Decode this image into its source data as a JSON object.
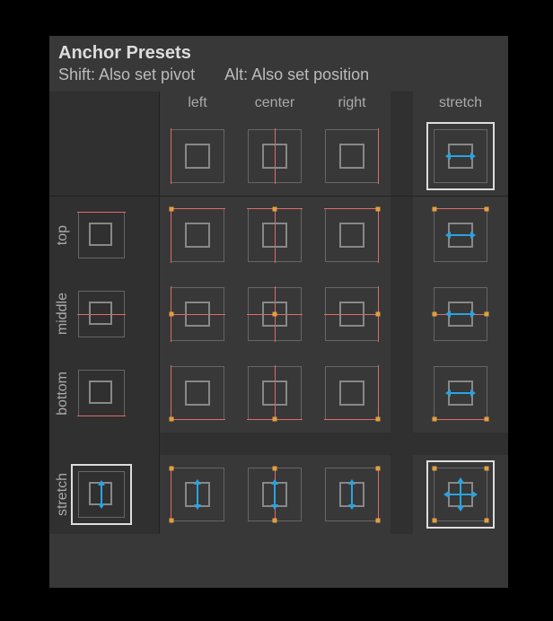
{
  "title": "Anchor Presets",
  "subtitle_shift": "Shift: Also set pivot",
  "subtitle_alt": "Alt: Also set position",
  "columns": [
    "left",
    "center",
    "right",
    "stretch"
  ],
  "rows": [
    "top",
    "middle",
    "bottom",
    "stretch"
  ],
  "selected_column": "stretch",
  "selected_row": "stretch",
  "colors": {
    "guide": "#e06a6a",
    "anchor_dot": "#e0a040",
    "arrow": "#2aa3e0",
    "panel_bg": "#383838"
  }
}
